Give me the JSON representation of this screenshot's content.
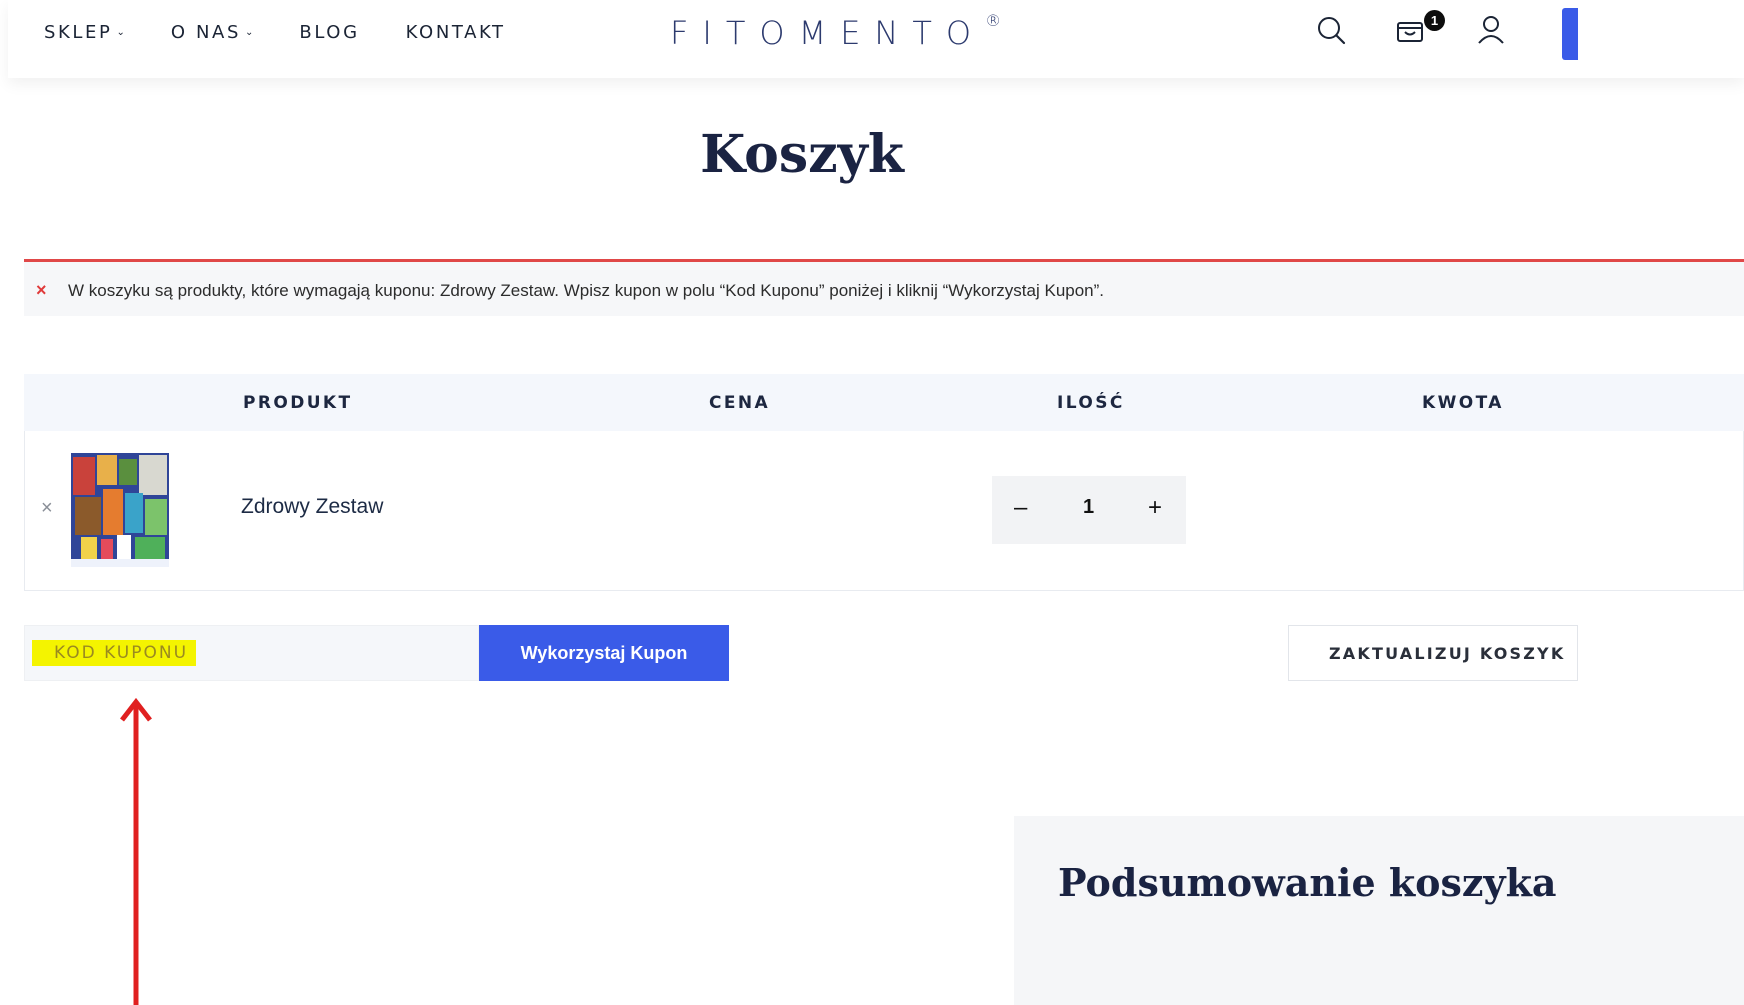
{
  "header": {
    "nav": [
      {
        "label": "SKLEP",
        "has_dropdown": true
      },
      {
        "label": "O NAS",
        "has_dropdown": true
      },
      {
        "label": "BLOG",
        "has_dropdown": false
      },
      {
        "label": "KONTAKT",
        "has_dropdown": false
      }
    ],
    "logo": "FITOMENTO",
    "logo_mark": "®",
    "cart_count": "1",
    "icons": [
      "search-icon",
      "cart-icon",
      "user-icon"
    ]
  },
  "page": {
    "title": "Koszyk"
  },
  "notice": {
    "icon": "×",
    "message": "W koszyku są produkty, które wymagają kuponu: Zdrowy Zestaw. Wpisz kupon w polu “Kod Kuponu” poniżej i kliknij “Wykorzystaj Kupon”."
  },
  "cart": {
    "columns": [
      "PRODUKT",
      "CENA",
      "ILOŚĆ",
      "KWOTA"
    ],
    "items": [
      {
        "remove": "×",
        "name": "Zdrowy Zestaw",
        "quantity": "1"
      }
    ],
    "qty_minus": "–",
    "qty_plus": "+"
  },
  "coupon": {
    "placeholder": "KOD KUPONU",
    "apply_label": "Wykorzystaj Kupon",
    "update_label": "ZAKTUALIZUJ KOSZYK"
  },
  "totals": {
    "title": "Podsumowanie koszyka"
  },
  "colors": {
    "accent": "#3a5be8",
    "error": "#e04848",
    "highlight": "#f4f400",
    "annotation_arrow": "#e02020"
  }
}
